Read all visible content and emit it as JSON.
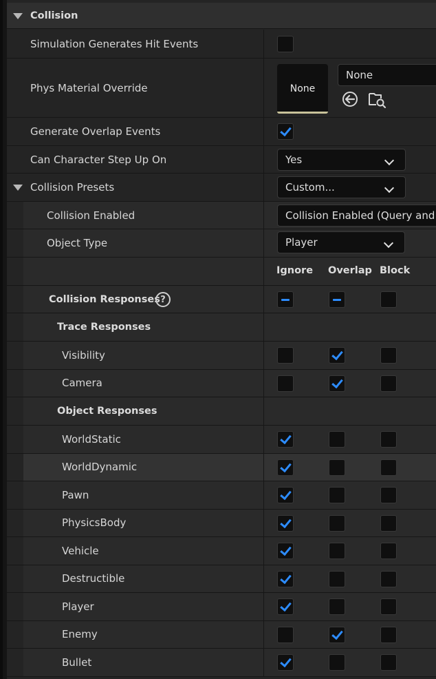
{
  "section": {
    "title": "Collision"
  },
  "rows": {
    "sim_hit": {
      "label": "Simulation Generates Hit Events",
      "checked": false
    },
    "phys_material": {
      "label": "Phys Material Override",
      "thumb_text": "None",
      "value": "None",
      "icons": [
        "use-selected-arrow-icon",
        "browse-folder-icon"
      ]
    },
    "overlap": {
      "label": "Generate Overlap Events",
      "checked": true
    },
    "step_up": {
      "label": "Can Character Step Up On",
      "value": "Yes"
    },
    "presets": {
      "label": "Collision Presets",
      "value": "Custom..."
    },
    "enabled": {
      "label": "Collision Enabled",
      "value": "Collision Enabled (Query and Ph"
    },
    "object_type": {
      "label": "Object Type",
      "value": "Player"
    }
  },
  "columns": [
    "Ignore",
    "Overlap",
    "Block"
  ],
  "collision_responses": {
    "label": "Collision Responses",
    "help_symbol": "?",
    "states": [
      "mixed",
      "mixed",
      "unchecked"
    ]
  },
  "trace_responses": {
    "label": "Trace Responses",
    "items": [
      {
        "label": "Visibility",
        "response": "Overlap"
      },
      {
        "label": "Camera",
        "response": "Overlap"
      }
    ]
  },
  "object_responses": {
    "label": "Object Responses",
    "items": [
      {
        "label": "WorldStatic",
        "response": "Ignore"
      },
      {
        "label": "WorldDynamic",
        "response": "Ignore",
        "highlighted": true
      },
      {
        "label": "Pawn",
        "response": "Ignore"
      },
      {
        "label": "PhysicsBody",
        "response": "Ignore"
      },
      {
        "label": "Vehicle",
        "response": "Ignore"
      },
      {
        "label": "Destructible",
        "response": "Ignore"
      },
      {
        "label": "Player",
        "response": "Ignore"
      },
      {
        "label": "Enemy",
        "response": "Overlap"
      },
      {
        "label": "Bullet",
        "response": "Ignore"
      }
    ]
  },
  "colors": {
    "accent": "#2d8cff",
    "background": "#242424",
    "header": "#2f2f2f",
    "field": "#0f0f0f"
  }
}
